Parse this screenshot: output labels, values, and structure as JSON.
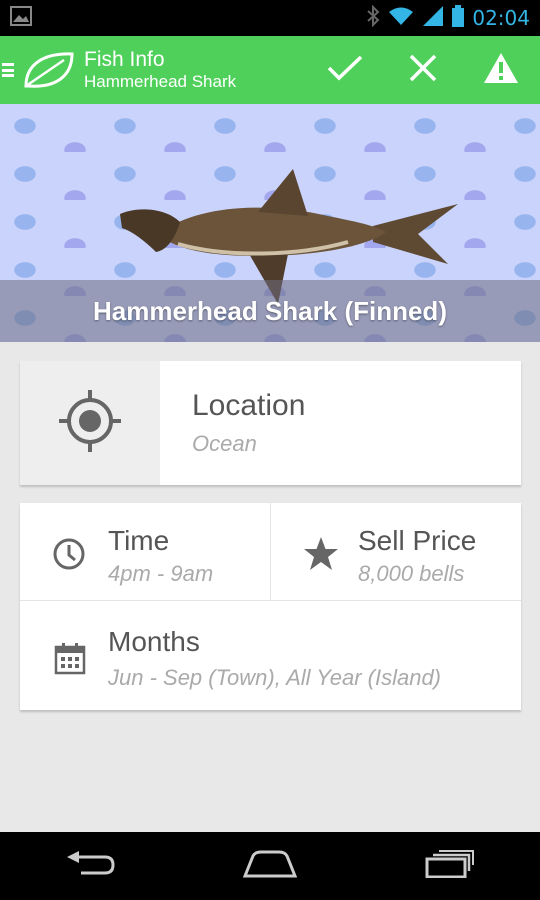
{
  "status_bar": {
    "time": "02:04",
    "icons": [
      "image-notification-icon",
      "bluetooth-icon",
      "wifi-icon",
      "signal-icon",
      "battery-icon"
    ]
  },
  "action_bar": {
    "title": "Fish Info",
    "subtitle": "Hammerhead Shark",
    "icons": [
      "menu-icon",
      "leaf-logo-icon",
      "check-icon",
      "close-icon",
      "warning-icon"
    ],
    "color": "#4fd05a"
  },
  "hero": {
    "caption": "Hammerhead Shark (Finned)",
    "image": "hammerhead-shark-image"
  },
  "location": {
    "title": "Location",
    "value": "Ocean",
    "icon": "gps-target-icon"
  },
  "time": {
    "title": "Time",
    "value": "4pm - 9am",
    "icon": "clock-icon"
  },
  "sell_price": {
    "title": "Sell Price",
    "value": "8,000 bells",
    "icon": "star-icon"
  },
  "months": {
    "title": "Months",
    "value": "Jun - Sep (Town), All Year (Island)",
    "icon": "calendar-icon"
  },
  "nav_bar": {
    "icons": [
      "back-icon",
      "home-icon",
      "recent-apps-icon"
    ]
  }
}
